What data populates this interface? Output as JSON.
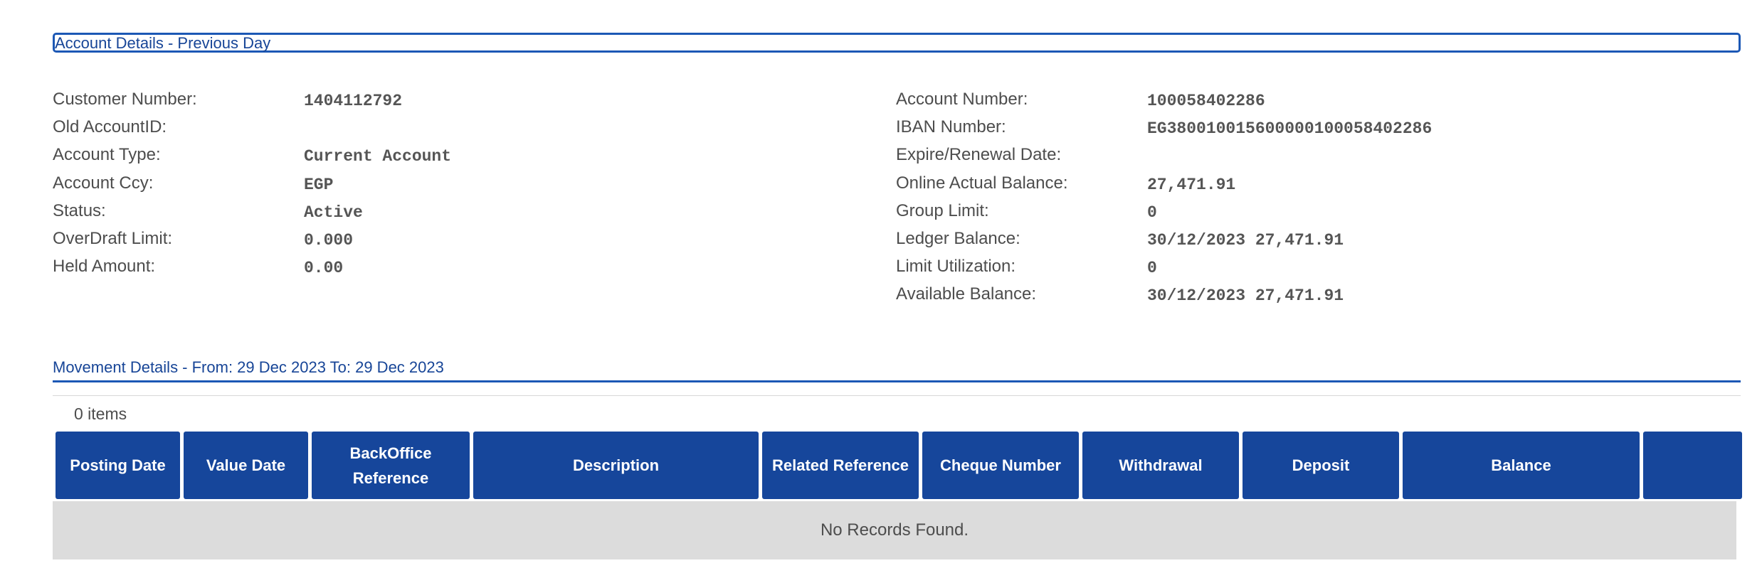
{
  "account_section": {
    "title": "Account Details - Previous Day"
  },
  "left_fields": [
    {
      "label": "Customer Number:",
      "value": "1404112792"
    },
    {
      "label": "Old AccountID:",
      "value": ""
    },
    {
      "label": "Account Type:",
      "value": "Current Account"
    },
    {
      "label": "Account Ccy:",
      "value": "EGP"
    },
    {
      "label": "Status:",
      "value": "Active"
    },
    {
      "label": "OverDraft Limit:",
      "value": "0.000"
    },
    {
      "label": "Held Amount:",
      "value": "0.00"
    }
  ],
  "right_fields": [
    {
      "label": "Account Number:",
      "value": "100058402286"
    },
    {
      "label": "IBAN Number:",
      "value": "EG380010015600000100058402286"
    },
    {
      "label": "Expire/Renewal Date:",
      "value": ""
    },
    {
      "label": "Online Actual Balance:",
      "value": "27,471.91"
    },
    {
      "label": "Group Limit:",
      "value": "0"
    },
    {
      "label": "Ledger Balance:",
      "value": "30/12/2023 27,471.91"
    },
    {
      "label": "Limit Utilization:",
      "value": "0"
    },
    {
      "label": "Available Balance:",
      "value": "30/12/2023 27,471.91"
    }
  ],
  "movement": {
    "title": "Movement Details - From: 29 Dec 2023 To: 29 Dec 2023",
    "items_count": "0 items",
    "columns": [
      "Posting Date",
      "Value Date",
      "BackOffice Reference",
      "Description",
      "Related Reference",
      "Cheque Number",
      "Withdrawal",
      "Deposit",
      "Balance",
      ""
    ],
    "empty_message": "No Records Found."
  }
}
